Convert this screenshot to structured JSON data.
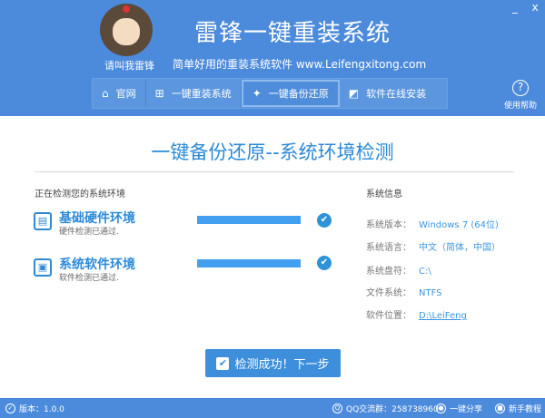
{
  "header": {
    "title": "雷锋一键重装系统",
    "nickname": "请叫我雷锋",
    "subtitle": "简单好用的重装系统软件 www.Leifengxitong.com",
    "minimize": "_",
    "close": "x",
    "help_label": "使用帮助",
    "help_icon": "?"
  },
  "nav": [
    {
      "label": "官网",
      "icon": "⌂"
    },
    {
      "label": "一键重装系统",
      "icon": "⊞"
    },
    {
      "label": "一键备份还原",
      "icon": "✦"
    },
    {
      "label": "软件在线安装",
      "icon": "◩"
    }
  ],
  "main": {
    "title": "一键备份还原--系统环境检测",
    "detect_label": "正在检测您的系统环境",
    "checks": [
      {
        "name": "基础硬件环境",
        "desc": "硬件检测已通过.",
        "icon": "▤",
        "progress": 100
      },
      {
        "name": "系统软件环境",
        "desc": "软件检测已通过.",
        "icon": "▣",
        "progress": 100
      }
    ],
    "check_mark": "✔",
    "info_title": "系统信息",
    "info": [
      {
        "key": "系统版本：",
        "value": "Windows 7 (64位)"
      },
      {
        "key": "系统语言：",
        "value": "中文（简体，中国）"
      },
      {
        "key": "系统盘符：",
        "value": "C:\\"
      },
      {
        "key": "文件系统：",
        "value": "NTFS"
      },
      {
        "key": "软件位置：",
        "value": "D:\\LeiFeng"
      }
    ],
    "next_button": "检测成功！下一步"
  },
  "footer": {
    "version": "版本：1.0.0",
    "qq": "QQ交流群：258738960",
    "share": "一键分享",
    "tutorial": "新手教程"
  },
  "colors": {
    "brand": "#4c8bdc",
    "accent": "#2b8ad8"
  }
}
